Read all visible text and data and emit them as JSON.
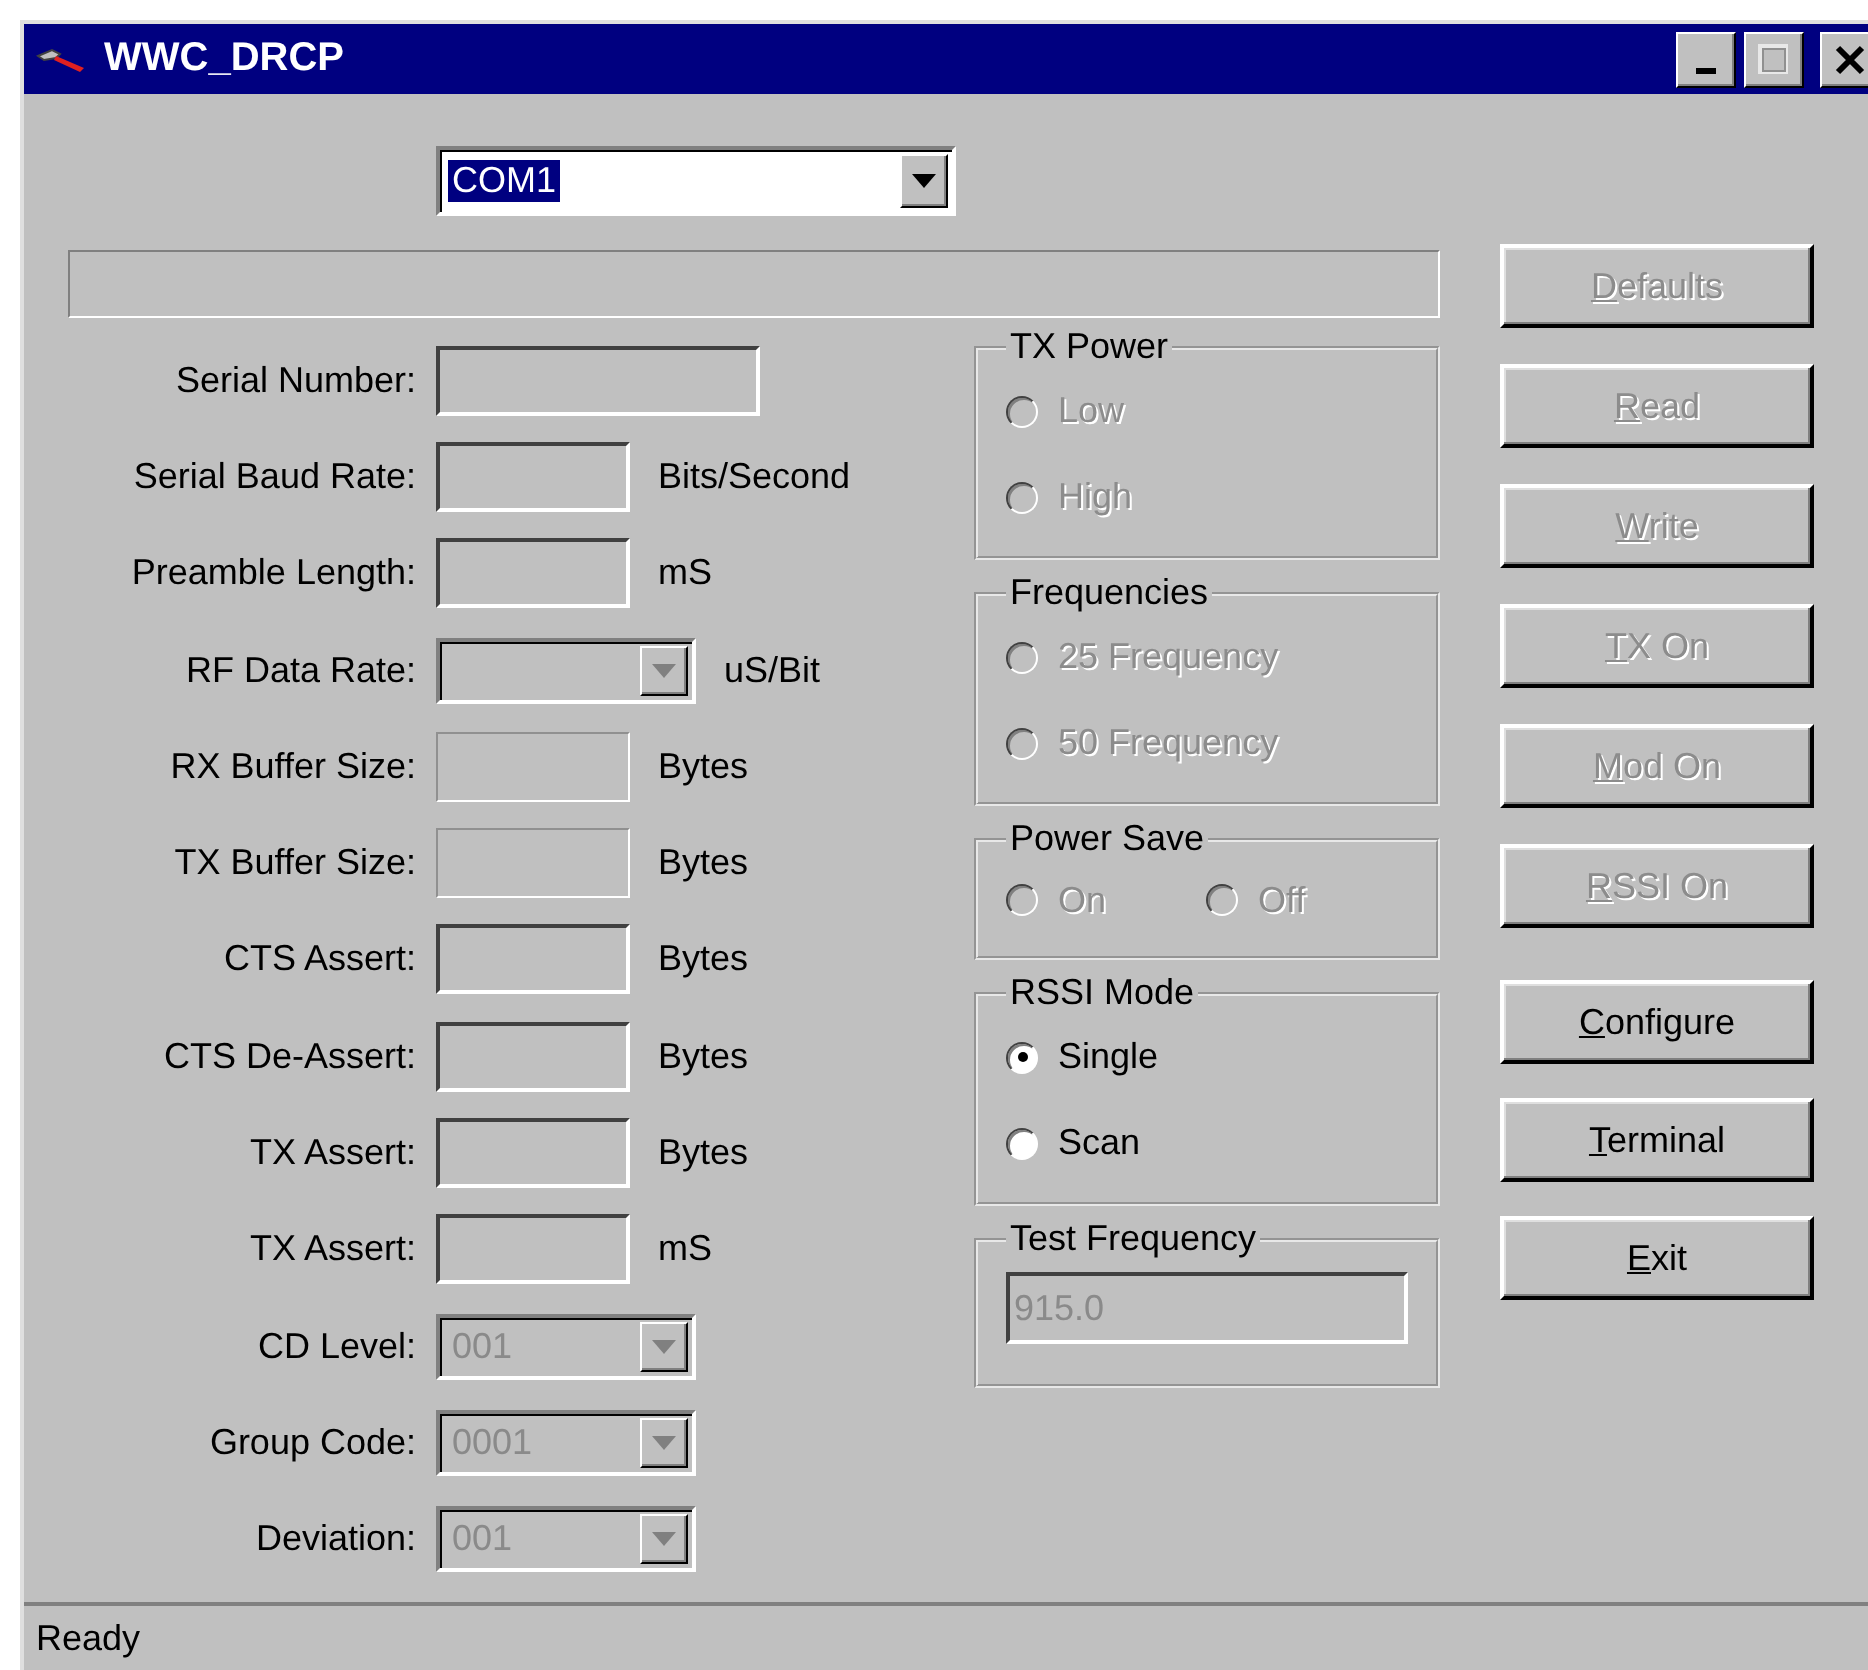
{
  "window": {
    "title": "WWC_DRCP",
    "maximize_enabled": false
  },
  "port": {
    "value": "COM1",
    "highlighted": true
  },
  "fields": [
    {
      "label": "Serial Number:",
      "kind": "long-text",
      "disabled": false
    },
    {
      "label": "Serial Baud Rate:",
      "kind": "text",
      "disabled": false,
      "unit": "Bits/Second"
    },
    {
      "label": "Preamble Length:",
      "kind": "text",
      "disabled": false,
      "unit": "mS"
    },
    {
      "label": "RF Data Rate:",
      "kind": "combo",
      "disabled": true,
      "unit": "uS/Bit"
    },
    {
      "label": "RX Buffer Size:",
      "kind": "text",
      "disabled": true,
      "unit": "Bytes"
    },
    {
      "label": "TX Buffer Size:",
      "kind": "text",
      "disabled": true,
      "unit": "Bytes"
    },
    {
      "label": "CTS Assert:",
      "kind": "text",
      "disabled": false,
      "unit": "Bytes"
    },
    {
      "label": "CTS De-Assert:",
      "kind": "text",
      "disabled": false,
      "unit": "Bytes"
    },
    {
      "label": "TX Assert:",
      "kind": "text",
      "disabled": false,
      "unit": "Bytes"
    },
    {
      "label": "TX Assert:",
      "kind": "text",
      "disabled": false,
      "unit": "mS"
    },
    {
      "label": "CD Level:",
      "kind": "combo",
      "disabled": true,
      "value": "001"
    },
    {
      "label": "Group Code:",
      "kind": "combo",
      "disabled": true,
      "value": "0001"
    },
    {
      "label": "Deviation:",
      "kind": "combo",
      "disabled": true,
      "value": "001"
    }
  ],
  "groups": [
    {
      "title": "TX Power",
      "kind": "column",
      "options": [
        {
          "label": "Low",
          "selected": false,
          "disabled": true
        },
        {
          "label": "High",
          "selected": false,
          "disabled": true
        }
      ]
    },
    {
      "title": "Frequencies",
      "kind": "column",
      "options": [
        {
          "label": "25 Frequency",
          "selected": false,
          "disabled": true
        },
        {
          "label": "50 Frequency",
          "selected": false,
          "disabled": true
        }
      ]
    },
    {
      "title": "Power Save",
      "kind": "row",
      "options": [
        {
          "label": "On",
          "selected": false,
          "disabled": true
        },
        {
          "label": "Off",
          "selected": false,
          "disabled": true
        }
      ]
    },
    {
      "title": "RSSI Mode",
      "kind": "column",
      "options": [
        {
          "label": "Single",
          "selected": true,
          "disabled": false
        },
        {
          "label": "Scan",
          "selected": false,
          "disabled": false
        }
      ]
    }
  ],
  "test_frequency": {
    "title": "Test Frequency",
    "value": "915.0",
    "disabled": true
  },
  "device_buttons": [
    {
      "label": "Defaults",
      "enabled": false
    },
    {
      "label": "Read",
      "enabled": false
    },
    {
      "label": "Write",
      "enabled": false
    },
    {
      "label": "TX On",
      "enabled": false
    },
    {
      "label": "Mod On",
      "enabled": false
    },
    {
      "label": "RSSI On",
      "enabled": false
    }
  ],
  "app_buttons": [
    {
      "label": "Configure",
      "enabled": true
    },
    {
      "label": "Terminal",
      "enabled": true
    },
    {
      "label": "Exit",
      "enabled": true
    }
  ],
  "status_bar": "Ready"
}
